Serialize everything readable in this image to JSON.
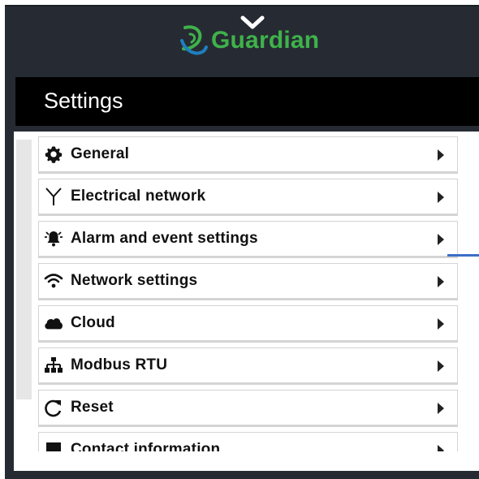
{
  "header": {
    "brand": "Guardian",
    "brand_color": "#3fb24a",
    "collapse_icon": "chevron-down-icon"
  },
  "settings_bar": {
    "title": "Settings"
  },
  "menu": {
    "items": [
      {
        "label": "General",
        "icon": "gear-icon"
      },
      {
        "label": "Electrical network",
        "icon": "antenna-icon"
      },
      {
        "label": "Alarm and event settings",
        "icon": "alarm-bell-icon"
      },
      {
        "label": "Network settings",
        "icon": "wifi-icon"
      },
      {
        "label": "Cloud",
        "icon": "cloud-icon"
      },
      {
        "label": "Modbus RTU",
        "icon": "sitemap-icon"
      },
      {
        "label": "Reset",
        "icon": "reset-icon"
      },
      {
        "label": "Contact information",
        "icon": "contact-icon"
      }
    ]
  },
  "accent_color": "#3b6fc6"
}
